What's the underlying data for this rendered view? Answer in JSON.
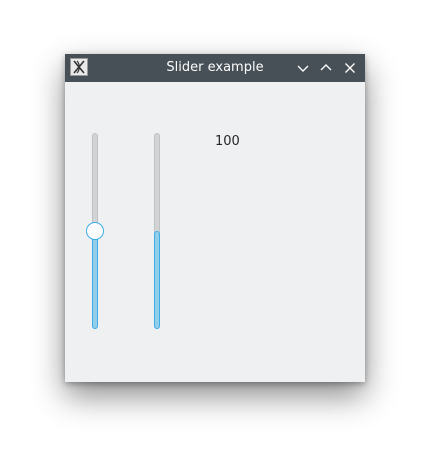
{
  "window": {
    "title": "Slider example",
    "icon": "x-app-icon",
    "buttons": [
      "minimize-icon",
      "maximize-icon",
      "close-icon"
    ]
  },
  "sliders": [
    {
      "name": "slider-1",
      "min": 0,
      "max": 100,
      "value": 50,
      "has_handle": true
    },
    {
      "name": "slider-2",
      "min": 0,
      "max": 100,
      "value": 50,
      "has_handle": false
    }
  ],
  "value_label": "100",
  "colors": {
    "titlebar": "#475057",
    "window_bg": "#eff0f1",
    "accent": "#3daee9",
    "fill": "#93cee9",
    "track": "#d1d3d5"
  }
}
